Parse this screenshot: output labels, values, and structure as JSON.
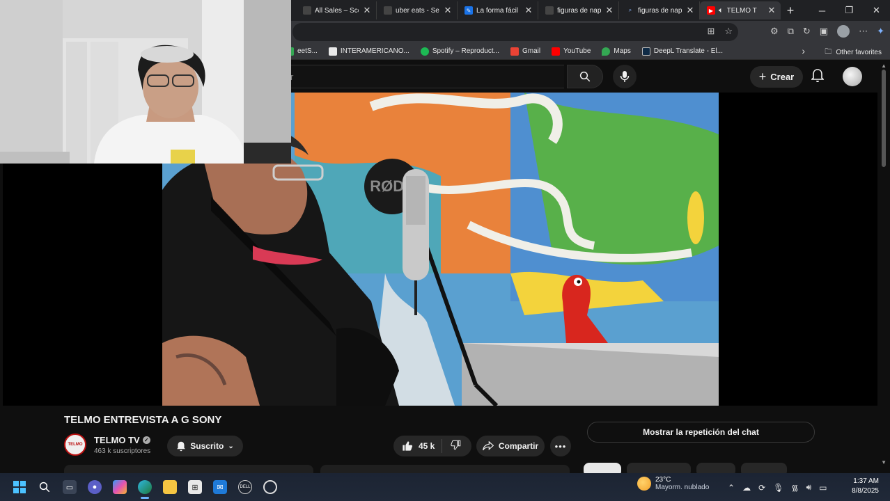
{
  "browser": {
    "tabs": [
      {
        "label": "All Sales – Sco",
        "icon": "page-icon",
        "active": false
      },
      {
        "label": "uber eats - Se",
        "icon": "page-icon",
        "active": false
      },
      {
        "label": "La forma fácil",
        "icon": "feather-icon",
        "active": false
      },
      {
        "label": "figuras de nap",
        "icon": "page-icon",
        "active": false
      },
      {
        "label": "figuras de nap",
        "icon": "search-icon",
        "active": false
      },
      {
        "label": "TELMO T",
        "icon": "youtube-icon",
        "active": true
      }
    ],
    "bookmarks": [
      {
        "label": "eetS...",
        "icon": "sheet-icon",
        "color": "#34a853"
      },
      {
        "label": "INTERAMERICANO...",
        "icon": "doc-icon",
        "color": "#e8e8e8"
      },
      {
        "label": "Spotify – Reproduct...",
        "icon": "spotify-icon",
        "color": "#1db954"
      },
      {
        "label": "Gmail",
        "icon": "gmail-icon",
        "color": "#ea4335"
      },
      {
        "label": "YouTube",
        "icon": "youtube-icon",
        "color": "#ff0000"
      },
      {
        "label": "Maps",
        "icon": "maps-icon",
        "color": "#34a853"
      },
      {
        "label": "DeepL Translate - El...",
        "icon": "deepl-icon",
        "color": "#0f2b46"
      }
    ],
    "other_favorites": "Other favorites"
  },
  "youtube": {
    "search_placeholder": "r",
    "create_label": "Crear",
    "video_title": "TELMO ENTREVISTA A G SONY",
    "channel": {
      "name": "TELMO TV",
      "subscribers": "463 k suscriptores",
      "avatar_text": "TELMO"
    },
    "subscribed_label": "Suscrito",
    "likes": "45 k",
    "share_label": "Compartir",
    "chat_replay_label": "Mostrar la repetición del chat",
    "scene_text": "RØDE"
  },
  "taskbar": {
    "weather_temp": "23°C",
    "weather_desc": "Mayorm. nublado",
    "time": "1:37 AM",
    "date": "8/8/2025"
  },
  "colors": {
    "youtube_bg": "#0f0f0f",
    "youtube_red": "#ff0000",
    "chrome_bg": "#202124",
    "toolbar_bg": "#35363a"
  }
}
